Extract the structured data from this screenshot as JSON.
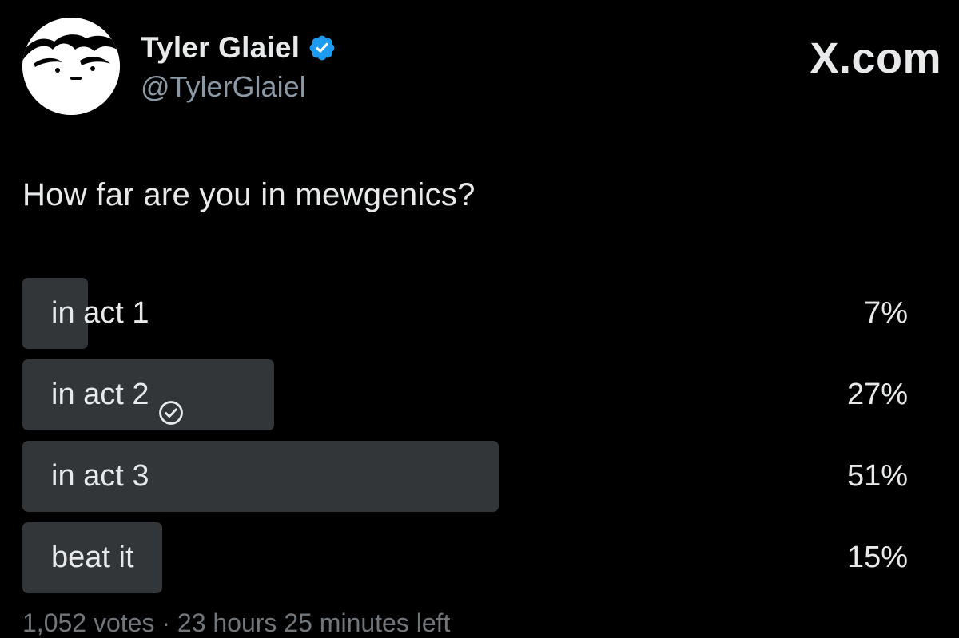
{
  "author": {
    "display_name": "Tyler Glaiel",
    "handle": "@TylerGlaiel",
    "verified": true,
    "avatar_icon": "cartoon-face-avatar",
    "verified_color": "#1d9bf0"
  },
  "site_label": "X.com",
  "post": {
    "question": "How far are you in mewgenics?"
  },
  "poll": {
    "options": [
      {
        "label": "in act 1",
        "percent_text": "7%",
        "percent": 7,
        "voted": false
      },
      {
        "label": "in act 2",
        "percent_text": "27%",
        "percent": 27,
        "voted": true
      },
      {
        "label": "in act 3",
        "percent_text": "51%",
        "percent": 51,
        "voted": false
      },
      {
        "label": "beat it",
        "percent_text": "15%",
        "percent": 15,
        "voted": false
      }
    ],
    "footer": "1,052 votes · 23 hours 25 minutes left",
    "bar_color": "#333639"
  }
}
